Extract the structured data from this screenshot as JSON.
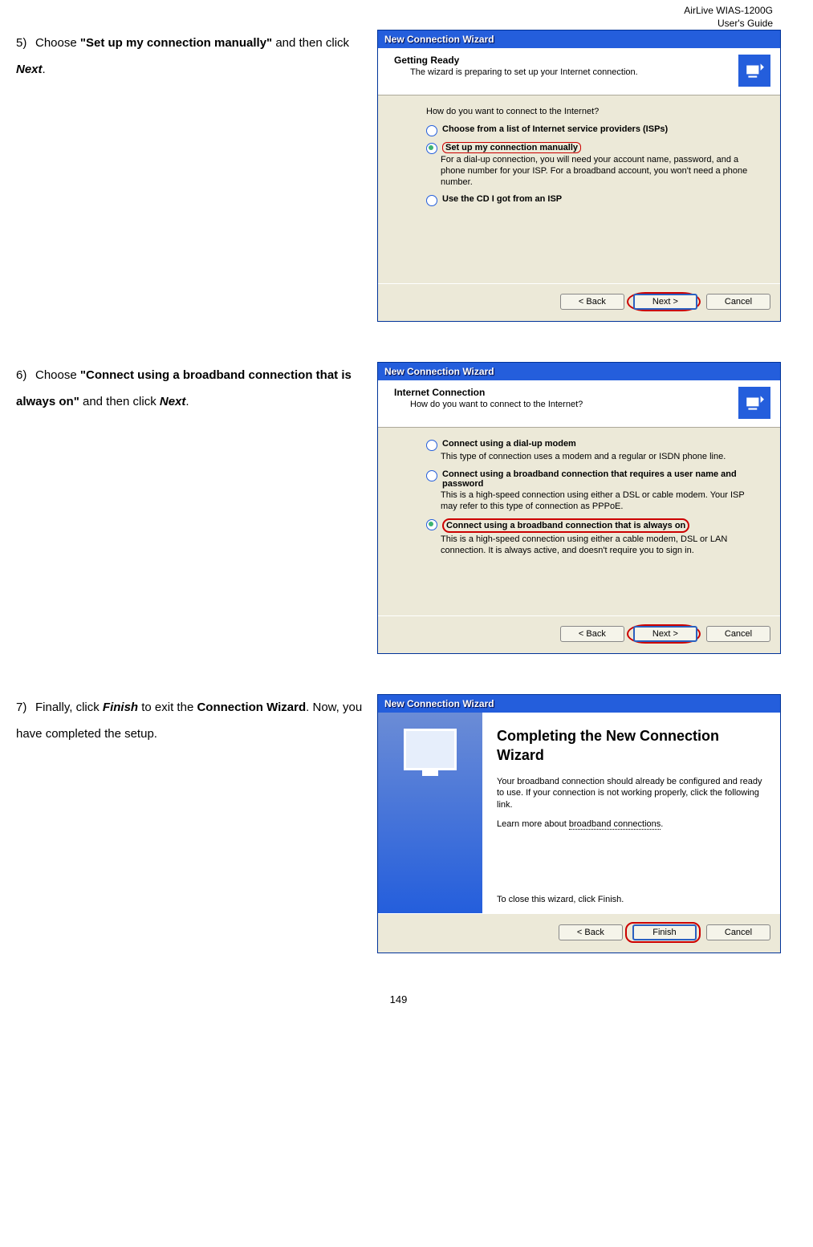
{
  "header": {
    "line1": "AirLive WIAS-1200G",
    "line2": "User's Guide"
  },
  "step5": {
    "number": "5)",
    "text_pre": "Choose ",
    "bold1": "\"Set up my connection manually\"",
    "text_mid": " and then click ",
    "em1": "Next",
    "text_post": ".",
    "wiz": {
      "title": "New Connection Wizard",
      "h_title": "Getting Ready",
      "h_sub": "The wizard is preparing to set up your Internet connection.",
      "question": "How do you want to connect to the Internet?",
      "opt1": "Choose from a list of Internet service providers (ISPs)",
      "opt2": "Set up my connection manually",
      "opt2_desc": "For a dial-up connection, you will need your account name, password, and a phone number for your ISP. For a broadband account, you won't need a phone number.",
      "opt3": "Use the CD I got from an ISP",
      "btn_back": "< Back",
      "btn_next": "Next >",
      "btn_cancel": "Cancel"
    }
  },
  "step6": {
    "number": "6)",
    "text_pre": "Choose ",
    "bold1": "\"Connect using a broadband connection that is always on\"",
    "text_mid": " and then click ",
    "em1": "Next",
    "text_post": ".",
    "wiz": {
      "title": "New Connection Wizard",
      "h_title": "Internet Connection",
      "h_sub": "How do you want to connect to the Internet?",
      "opt1": "Connect using a dial-up modem",
      "opt1_desc": "This type of connection uses a modem and a regular or ISDN phone line.",
      "opt2": "Connect using a broadband connection that requires a user name and password",
      "opt2_desc": "This is a high-speed connection using either a DSL or cable modem. Your ISP may refer to this type of connection as PPPoE.",
      "opt3": "Connect using a broadband connection that is always on",
      "opt3_desc": "This is a high-speed connection using either a cable modem, DSL or LAN connection. It is always active, and doesn't require you to sign in.",
      "btn_back": "< Back",
      "btn_next": "Next >",
      "btn_cancel": "Cancel"
    }
  },
  "step7": {
    "number": "7)",
    "text_pre": "Finally, click ",
    "em1": "Finish",
    "text_mid": " to exit the ",
    "bold1": "Connection Wizard",
    "text_post": ". Now, you have completed the setup.",
    "wiz": {
      "title": "New Connection Wizard",
      "heading": "Completing the New Connection Wizard",
      "para1": "Your broadband connection should already be configured and ready to use. If your connection is not working properly, click the following link.",
      "para2_pre": "Learn more about ",
      "para2_link": "broadband connections",
      "para2_post": ".",
      "close": "To close this wizard, click Finish.",
      "btn_back": "< Back",
      "btn_finish": "Finish",
      "btn_cancel": "Cancel"
    }
  },
  "page_number": "149"
}
